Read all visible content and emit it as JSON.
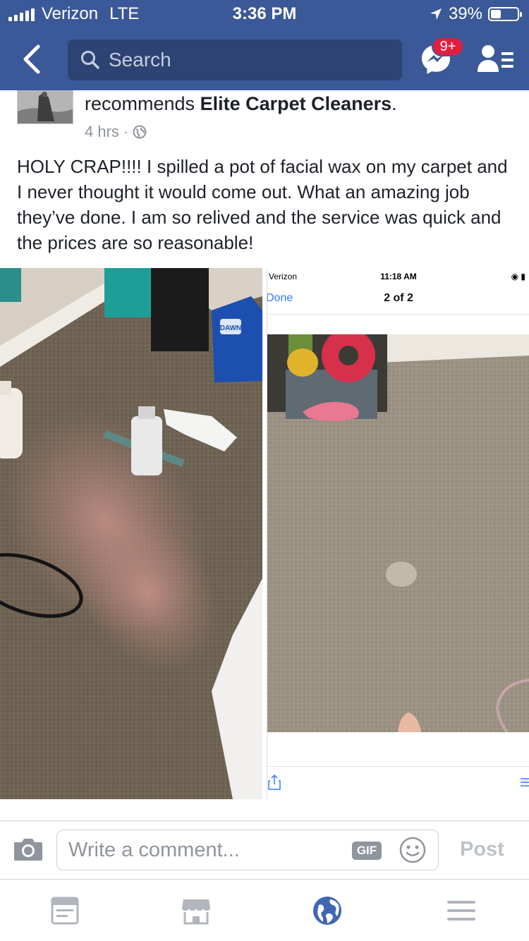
{
  "status_bar": {
    "carrier": "Verizon",
    "network": "LTE",
    "time": "3:36 PM",
    "battery": "39%",
    "battery_level": 0.39
  },
  "nav": {
    "search_placeholder": "Search",
    "messenger_badge": "9+"
  },
  "post": {
    "headline_prefix": "recommends ",
    "page_name": "Elite Carpet Cleaners",
    "headline_suffix": ".",
    "time_ago": "4 hrs",
    "separator": "·",
    "body": "HOLY CRAP!!!! I spilled a pot of facial wax on my carpet and I never thought it would come out. What an amazing job they’ve done. I am so relived and the service was quick and the prices are so reasonable!",
    "photos": {
      "screenshot_carrier": "Verizon",
      "screenshot_time": "11:18 AM",
      "screenshot_done": "Done",
      "screenshot_position": "2 of 2",
      "bottle_label": "DAWN"
    }
  },
  "comment_bar": {
    "placeholder": "Write a comment...",
    "gif_label": "GIF",
    "post_label": "Post"
  },
  "colors": {
    "brand": "#3b5998",
    "badge": "#e41e3f",
    "tab_active": "#4267b2",
    "tab_inactive": "#b1b5bc"
  },
  "tabs": [
    "news-feed",
    "marketplace",
    "notifications",
    "menu"
  ]
}
